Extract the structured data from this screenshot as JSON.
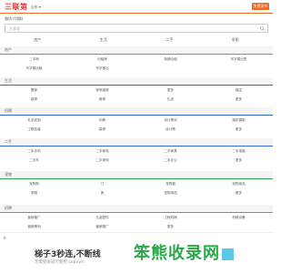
{
  "header": {
    "logo_text": "三联第",
    "city": "山东 ▾",
    "publish_label": "免费发布"
  },
  "location": {
    "region": "潍坊",
    "sub": "(切换)"
  },
  "search": {
    "placeholder": "大家说"
  },
  "top_links": [
    "房产",
    "生活",
    "二手",
    "求职"
  ],
  "sections": [
    {
      "title": "房产",
      "color": "#f06a24",
      "items": [
        "二手房",
        "出租房",
        "商铺出租",
        "写字楼出售",
        "写字楼出租",
        "写字楼出",
        "",
        ""
      ]
    },
    {
      "title": "生活",
      "color": "#2a6bd6",
      "items": [
        "搬家",
        "家电维修",
        "更多",
        "保洁",
        "装修",
        "维修",
        "礼品",
        "更多"
      ]
    },
    {
      "title": "招聘",
      "color": "#2a6bd6",
      "items": [
        "礼品定制",
        "印刷",
        "设计策划",
        "婚庆摄影",
        "工程包装",
        "装修",
        "设计策",
        "更多"
      ]
    },
    {
      "title": "二手",
      "color": "#2a6bd6",
      "items": [
        "二手手机",
        "二手家电",
        "二手家具",
        "二手电脑",
        "二手车",
        "二手家电",
        "二手办公",
        "更多"
      ]
    },
    {
      "title": "宠物",
      "color": "#2aa84a",
      "items": [
        "宠物狗",
        "门",
        "宠物猫",
        "宠物用品",
        "宠物",
        "鱼",
        "宠物用品",
        "更多"
      ]
    },
    {
      "title": "招聘",
      "color": "#f06a24",
      "items": [
        "营销推广",
        "五金配件",
        "工程机械",
        "机械设备",
        "营销策划",
        "营销推广",
        "更多",
        ""
      ]
    }
  ],
  "ad": {
    "close": "×",
    "title": "梯子3秒连,不断线",
    "subtitle": "无需登录就可使用 Lebuyin",
    "logo_text": "笨熊收录网"
  }
}
